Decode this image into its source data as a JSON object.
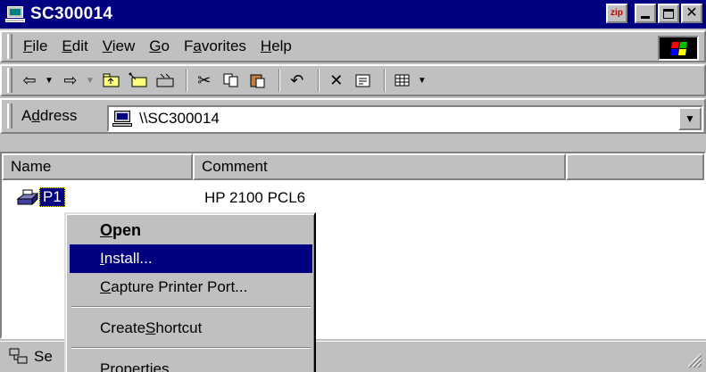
{
  "window": {
    "title": "SC300014",
    "zip_badge": "zip"
  },
  "menu": [
    {
      "pre": "",
      "key": "F",
      "post": "ile"
    },
    {
      "pre": "",
      "key": "E",
      "post": "dit"
    },
    {
      "pre": "",
      "key": "V",
      "post": "iew"
    },
    {
      "pre": "",
      "key": "G",
      "post": "o"
    },
    {
      "pre": "F",
      "key": "a",
      "post": "vorites"
    },
    {
      "pre": "",
      "key": "H",
      "post": "elp"
    }
  ],
  "address": {
    "pre": "A",
    "key": "d",
    "post": "dress",
    "value": "\\\\SC300014"
  },
  "columns": {
    "name": "Name",
    "comment": "Comment"
  },
  "row": {
    "name": "P1",
    "comment": "HP 2100 PCL6"
  },
  "status": {
    "text": "Se"
  },
  "context_menu": {
    "open": {
      "key": "O",
      "post": "pen"
    },
    "install": {
      "key": "I",
      "post": "nstall..."
    },
    "capture": {
      "key": "C",
      "post": "apture Printer Port..."
    },
    "shortcut": {
      "pre": "Create ",
      "key": "S",
      "post": "hortcut"
    },
    "properties": "Properties"
  },
  "colors": {
    "title_bar": "#000080",
    "selection": "#000080",
    "face": "#c0c0c0"
  }
}
